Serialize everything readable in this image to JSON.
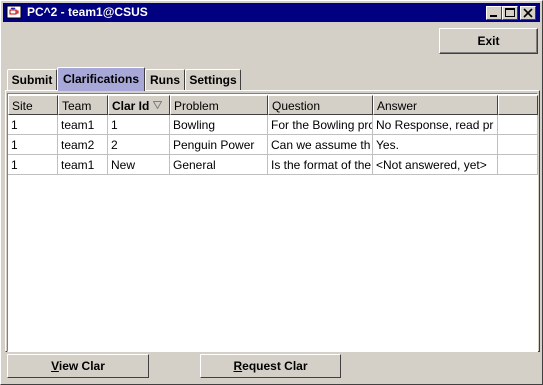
{
  "window": {
    "title": "PC^2 - team1@CSUS",
    "minimize_label": "minimize",
    "maximize_label": "maximize",
    "close_label": "close"
  },
  "toolbar": {
    "exit_label": "Exit"
  },
  "tabs": [
    {
      "label": "Submit",
      "active": false
    },
    {
      "label": "Clarifications",
      "active": true
    },
    {
      "label": "Runs",
      "active": false
    },
    {
      "label": "Settings",
      "active": false
    }
  ],
  "table": {
    "columns": [
      "Site",
      "Team",
      "Clar Id",
      "Problem",
      "Question",
      "Answer",
      ""
    ],
    "sorted_column": "Clar Id",
    "rows": [
      [
        "1",
        "team1",
        "1",
        "Bowling",
        "For the Bowling pro",
        "No Response, read pr"
      ],
      [
        "1",
        "team2",
        "2",
        "Penguin Power",
        "Can we assume th",
        "Yes."
      ],
      [
        "1",
        "team1",
        "New",
        "General",
        "Is the format of the",
        "<Not answered, yet>"
      ]
    ]
  },
  "actions": {
    "view_clar_first": "V",
    "view_clar_rest": "iew Clar",
    "request_clar_first": "R",
    "request_clar_rest": "equest Clar"
  }
}
